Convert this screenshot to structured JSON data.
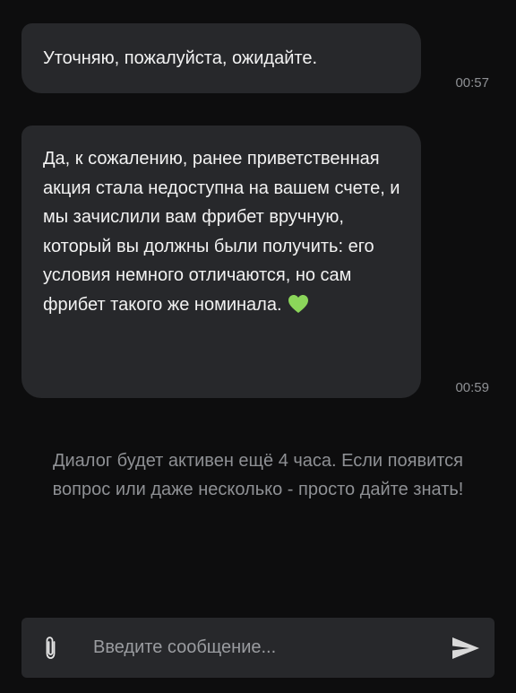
{
  "messages": [
    {
      "text": "Уточняю, пожалуйста, ожидайте.",
      "time": "00:57"
    },
    {
      "text": "Да, к сожалению, ранее приветственная акция стала недоступна на вашем счете, и мы зачислили вам фрибет вручную, который вы должны были получить: его условия немного отличаются, но сам фрибет такого же номинала.",
      "emoji": "green-heart-icon",
      "time": "00:59"
    }
  ],
  "system_notice": "Диалог будет активен ещё 4 часа. Если появится вопрос или даже несколько - просто дайте знать!",
  "composer": {
    "placeholder": "Введите сообщение...",
    "value": "",
    "attach_icon": "paperclip-icon",
    "send_icon": "send-icon"
  },
  "colors": {
    "background": "#0d0d0e",
    "bubble": "#27282b",
    "text": "#f2f2f2",
    "muted": "#8e9094",
    "heart": "#8bd65a"
  }
}
